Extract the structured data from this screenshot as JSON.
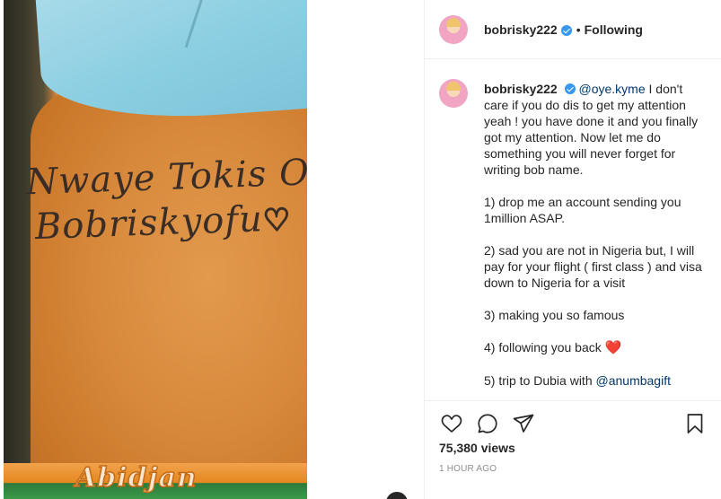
{
  "media": {
    "tattoo_line1": "Nwaye Tokis Olanre",
    "tattoo_line2": "Bobriskyofu",
    "tattoo_heart": "♡",
    "band_text": "Abidjan"
  },
  "header": {
    "username": "bobrisky222",
    "separator": "•",
    "follow_label": "Following"
  },
  "caption": {
    "username": "bobrisky222",
    "mention": "@oye.kyme",
    "intro": " I don't care if you do dis to get my attention yeah ! you have done it and you finally got my attention. Now let me do something you will never forget for writing bob name.",
    "item1": "1) drop me an account sending you 1million ASAP.",
    "item2": "2) sad you are not in Nigeria but, I will pay for your flight ( first class ) and visa down to Nigeria for a visit",
    "item3": "3) making you so famous",
    "item4": "4) following you back ",
    "item4_emoji": "❤️",
    "item5_prefix": "5) trip to Dubia with ",
    "item5_mention": "@anumbagift"
  },
  "stats": {
    "views": "75,380 views",
    "time": "1 HOUR AGO"
  },
  "icons": [
    "verified-badge-icon",
    "heart-icon",
    "comment-icon",
    "share-icon",
    "bookmark-icon"
  ],
  "colors": {
    "verified": "#3897f0",
    "mention": "#00376b",
    "heart_emoji": "#e0245e",
    "muted": "#8e8e8e"
  }
}
